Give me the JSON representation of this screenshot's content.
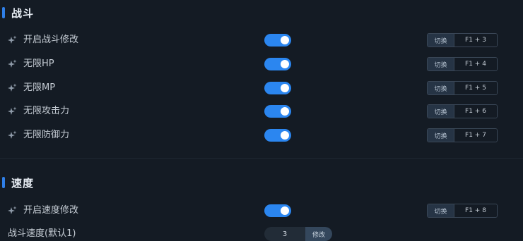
{
  "sections": [
    {
      "title": "战斗",
      "rows": [
        {
          "label": "开启战斗修改",
          "enabled": true,
          "switch_label": "切换",
          "hotkey": "F1 + 3"
        },
        {
          "label": "无限HP",
          "enabled": true,
          "switch_label": "切换",
          "hotkey": "F1 + 4"
        },
        {
          "label": "无限MP",
          "enabled": true,
          "switch_label": "切换",
          "hotkey": "F1 + 5"
        },
        {
          "label": "无限攻击力",
          "enabled": true,
          "switch_label": "切换",
          "hotkey": "F1 + 6"
        },
        {
          "label": "无限防御力",
          "enabled": true,
          "switch_label": "切换",
          "hotkey": "F1 + 7"
        }
      ]
    },
    {
      "title": "速度",
      "rows": [
        {
          "label": "开启速度修改",
          "enabled": true,
          "switch_label": "切换",
          "hotkey": "F1 + 8"
        }
      ],
      "value_setting": {
        "label": "战斗速度(默认1)",
        "value": "3",
        "button_label": "修改"
      }
    }
  ],
  "colors": {
    "background": "#141b24",
    "accent": "#2f7fe8",
    "toggle_on": "#2b86f0"
  },
  "icons": {
    "row_icon": "sparkle-icon"
  }
}
